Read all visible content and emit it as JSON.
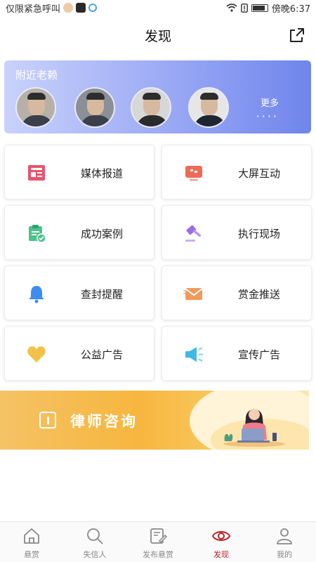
{
  "status_bar": {
    "left_text": "仅限紧急呼叫",
    "time": "傍晚6:37"
  },
  "header": {
    "title": "发现"
  },
  "nearby": {
    "title": "附近老赖",
    "more_label": "更多",
    "more_dots": "····"
  },
  "grid": {
    "items": [
      {
        "label": "媒体报道",
        "icon": "newspaper-icon",
        "color": "#e8546d"
      },
      {
        "label": "大屏互动",
        "icon": "monitor-icon",
        "color": "#f06a55"
      },
      {
        "label": "成功案例",
        "icon": "clipboard-check-icon",
        "color": "#4cc38a"
      },
      {
        "label": "执行现场",
        "icon": "gavel-icon",
        "color": "#9b6ee6"
      },
      {
        "label": "查封提醒",
        "icon": "bell-icon",
        "color": "#3d8df0"
      },
      {
        "label": "赏金推送",
        "icon": "envelope-icon",
        "color": "#f29a5a"
      },
      {
        "label": "公益广告",
        "icon": "heart-icon",
        "color": "#f3c24b"
      },
      {
        "label": "宣传广告",
        "icon": "megaphone-icon",
        "color": "#3fb8e8"
      }
    ]
  },
  "lawyer_banner": {
    "title": "律师咨询"
  },
  "bottom_nav": {
    "items": [
      {
        "label": "悬赏",
        "icon": "home-icon"
      },
      {
        "label": "失信人",
        "icon": "search-icon"
      },
      {
        "label": "发布悬赏",
        "icon": "edit-icon"
      },
      {
        "label": "发现",
        "icon": "eye-icon",
        "active": true
      },
      {
        "label": "我的",
        "icon": "user-icon"
      }
    ],
    "active_color": "#b8242a"
  }
}
